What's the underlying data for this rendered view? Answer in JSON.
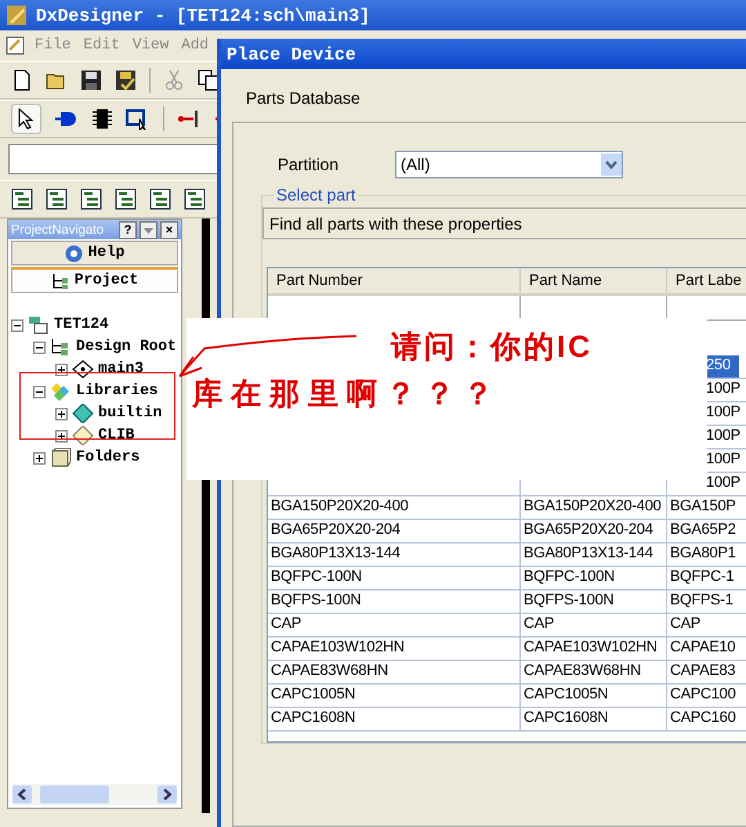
{
  "window": {
    "title": "DxDesigner - [TET124:sch\\main3]"
  },
  "menu": [
    "File",
    "Edit",
    "View",
    "Add"
  ],
  "navigator": {
    "title": "ProjectNavigato",
    "help_button": "?",
    "close_button": "×",
    "tabs": [
      {
        "label": "Help",
        "selected": false
      },
      {
        "label": "Project",
        "selected": true
      }
    ],
    "tree": [
      {
        "label": "TET124",
        "kind": "project",
        "expanded": true,
        "children": [
          {
            "label": "Design Root",
            "kind": "root",
            "expanded": true,
            "children": [
              {
                "label": "main3",
                "kind": "sheet",
                "expanded": false
              }
            ]
          },
          {
            "label": "Libraries",
            "kind": "library",
            "expanded": true,
            "children": [
              {
                "label": "builtin",
                "kind": "lib-m",
                "expanded": false
              },
              {
                "label": "CLIB",
                "kind": "lib-r",
                "expanded": false
              }
            ]
          },
          {
            "label": "Folders",
            "kind": "folder",
            "expanded": false
          }
        ]
      }
    ]
  },
  "dialog": {
    "title": "Place Device",
    "tab": "Parts Database",
    "partition_label": "Partition",
    "partition_value": "(All)",
    "group_label": "Select part",
    "filter_text": "Find all parts with these properties",
    "columns": [
      "Part Number",
      "Part Name",
      "Part Labe"
    ],
    "rows": [
      {
        "label": "250",
        "selected": true
      },
      {
        "label": "100P",
        "selected": false
      },
      {
        "label": "100P",
        "selected": false
      },
      {
        "label": "100P",
        "selected": false
      },
      {
        "label": "100P",
        "selected": false
      },
      {
        "label": "100P",
        "selected": false
      },
      {
        "number": "BGA150P20X20-400",
        "name": "BGA150P20X20-400",
        "label": "BGA150P",
        "selected": false
      },
      {
        "number": "BGA65P20X20-204",
        "name": "BGA65P20X20-204",
        "label": "BGA65P2",
        "selected": false
      },
      {
        "number": "BGA80P13X13-144",
        "name": "BGA80P13X13-144",
        "label": "BGA80P1",
        "selected": false
      },
      {
        "number": "BQFPC-100N",
        "name": "BQFPC-100N",
        "label": "BQFPC-1",
        "selected": false
      },
      {
        "number": "BQFPS-100N",
        "name": "BQFPS-100N",
        "label": "BQFPS-1",
        "selected": false
      },
      {
        "number": "CAP",
        "name": "CAP",
        "label": "CAP",
        "selected": false
      },
      {
        "number": "CAPAE103W102HN",
        "name": "CAPAE103W102HN",
        "label": "CAPAE10",
        "selected": false
      },
      {
        "number": "CAPAE83W68HN",
        "name": "CAPAE83W68HN",
        "label": "CAPAE83",
        "selected": false
      },
      {
        "number": "CAPC1005N",
        "name": "CAPC1005N",
        "label": "CAPC100",
        "selected": false
      },
      {
        "number": "CAPC1608N",
        "name": "CAPC1608N",
        "label": "CAPC160",
        "selected": false
      }
    ]
  },
  "annotation": {
    "lines": [
      "请问：你的IC",
      "库在那里啊？？？"
    ]
  }
}
